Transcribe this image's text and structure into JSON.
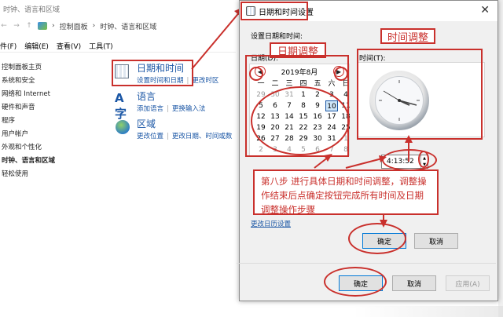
{
  "background": {
    "window_title": "时钟、语言和区域",
    "breadcrumb": [
      "控制面板",
      "时钟、语言和区域"
    ],
    "menu": [
      "件(F)",
      "编辑(E)",
      "查看(V)",
      "工具(T)"
    ],
    "sidebar": {
      "items": [
        {
          "label": "控制面板主页"
        },
        {
          "label": "系统和安全"
        },
        {
          "label": "网络和 Internet"
        },
        {
          "label": "硬件和声音"
        },
        {
          "label": "程序"
        },
        {
          "label": "用户帐户"
        },
        {
          "label": "外观和个性化"
        },
        {
          "label": "时钟、语言和区域"
        },
        {
          "label": "轻松使用"
        }
      ]
    },
    "categories": [
      {
        "title": "日期和时间",
        "links": [
          "设置时间和日期",
          "更改时区"
        ]
      },
      {
        "title": "语言",
        "links": [
          "添加语言",
          "更换输入法"
        ]
      },
      {
        "title": "区域",
        "links": [
          "更改位置",
          "更改日期、时间或数"
        ]
      }
    ]
  },
  "dialog": {
    "title": "日期和时间设置",
    "set_label": "设置日期和时间:",
    "date_label": "日期(D):",
    "time_label": "时间(T):",
    "calendar": {
      "month_label": "2019年8月",
      "weekdays": [
        "一",
        "二",
        "三",
        "四",
        "五",
        "六",
        "日"
      ],
      "days": [
        [
          "29",
          "30",
          "31",
          "1",
          "2",
          "3",
          "4"
        ],
        [
          "5",
          "6",
          "7",
          "8",
          "9",
          "10",
          "11"
        ],
        [
          "12",
          "13",
          "14",
          "15",
          "16",
          "17",
          "18"
        ],
        [
          "19",
          "20",
          "21",
          "22",
          "23",
          "24",
          "25"
        ],
        [
          "26",
          "27",
          "28",
          "29",
          "30",
          "31",
          "1"
        ],
        [
          "2",
          "3",
          "4",
          "5",
          "6",
          "7",
          "8"
        ]
      ],
      "today": "10"
    },
    "time_value": "4:13:52",
    "change_calendar_link": "更改日历设置",
    "ok": "确定",
    "cancel": "取消"
  },
  "outer_buttons": {
    "ok": "确定",
    "cancel": "取消",
    "apply": "应用(A)"
  },
  "annotations": {
    "date_adjust": "日期调整",
    "time_adjust": "时间调整",
    "step_note": "第八步 进行具体日期和时间调整，调整操作结束后点确定按钮完成所有时间及日期调整操作步骤"
  },
  "colors": {
    "annotation_red": "#c9302c",
    "link_blue": "#1a56a5",
    "accent": "#0078d7"
  }
}
